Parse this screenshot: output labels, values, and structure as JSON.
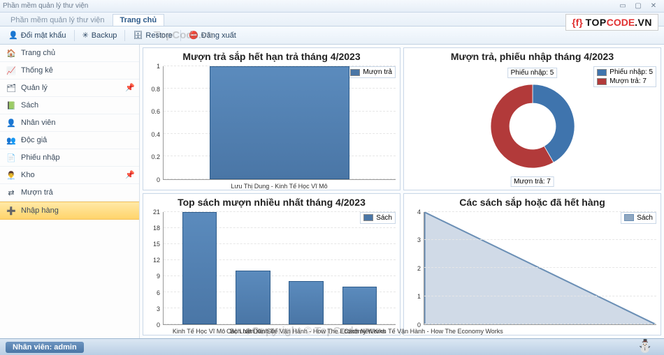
{
  "app_title": "Phần mềm quản lý thư viện",
  "active_tab": "Trang chủ",
  "watermark_text": "TopCode.vn",
  "copyright_text": "Copyright © TopCode.vn",
  "logo": {
    "prefix": "{f}",
    "brand1": "TOP",
    "brand2": "CODE",
    "suffix": ".VN"
  },
  "toolbar": {
    "change_password": "Đổi mật khẩu",
    "backup": "Backup",
    "restore": "Restore",
    "logout": "Đăng xuất"
  },
  "sidebar": {
    "items": [
      {
        "label": "Trang chủ",
        "icon": "🏠"
      },
      {
        "label": "Thống kê",
        "icon": "📈"
      },
      {
        "label": "Quản lý",
        "icon": "🗂",
        "highlight": true
      },
      {
        "label": "Sách",
        "icon": "📗"
      },
      {
        "label": "Nhân viên",
        "icon": "👤"
      },
      {
        "label": "Độc giả",
        "icon": "👥"
      },
      {
        "label": "Phiếu nhập",
        "icon": "📄"
      },
      {
        "label": "Kho",
        "icon": "👨‍💼",
        "highlight": true
      },
      {
        "label": "Mượn trả",
        "icon": "⇄"
      },
      {
        "label": "Nhập hàng",
        "icon": "➕",
        "selected": true
      }
    ]
  },
  "status": {
    "user_label": "Nhân viên: admin"
  },
  "panels": {
    "p1": {
      "title": "Mượn trả sắp hết hạn trả tháng 4/2023",
      "legend": "Mượn trả"
    },
    "p2": {
      "title": "Mượn trả, phiếu nhập tháng 4/2023",
      "legend1": "Phiếu nhập: 5",
      "legend2": "Mượn trả: 7",
      "label1": "Phiếu nhập: 5",
      "label2": "Mượn trả: 7"
    },
    "p3": {
      "title": "Top sách mượn nhiều nhất tháng 4/2023",
      "legend": "Sách"
    },
    "p4": {
      "title": "Các sách sắp hoặc đã hết hàng",
      "legend": "Sách"
    }
  },
  "chart_data": [
    {
      "id": "p1",
      "type": "bar",
      "categories": [
        "Lưu Thị Dung - Kinh Tế Học Vĩ Mô"
      ],
      "values": [
        1
      ],
      "ylim": [
        0,
        1
      ],
      "yticks": [
        0,
        0.2,
        0.4,
        0.6,
        0.8,
        1
      ],
      "series_name": "Mượn trả",
      "color": "#4a76a6"
    },
    {
      "id": "p2",
      "type": "pie",
      "series": [
        {
          "name": "Phiếu nhập",
          "value": 5,
          "color": "#3f74ad"
        },
        {
          "name": "Mượn trả",
          "value": 7,
          "color": "#b23a3a"
        }
      ],
      "donut": true
    },
    {
      "id": "p3",
      "type": "bar",
      "categories": [
        "Kinh Tế Học Vĩ Mô",
        "Bộ Luật Dân Sự",
        "Cách Nền Kinh Tế Vận Hành - How The Economy Works"
      ],
      "values": [
        21,
        10,
        8,
        7
      ],
      "ylim": [
        0,
        21
      ],
      "yticks": [
        0,
        3,
        6,
        9,
        12,
        15,
        18,
        21
      ],
      "series_name": "Sách",
      "color": "#4a76a6"
    },
    {
      "id": "p4",
      "type": "area",
      "x": [
        "Cách Nền Kinh Tế Vận Hành - How The Economy Works",
        ""
      ],
      "values": [
        4,
        0
      ],
      "ylim": [
        0,
        4
      ],
      "yticks": [
        0,
        1,
        2,
        3,
        4
      ],
      "series_name": "Sách",
      "color": "#90a8c2"
    }
  ]
}
